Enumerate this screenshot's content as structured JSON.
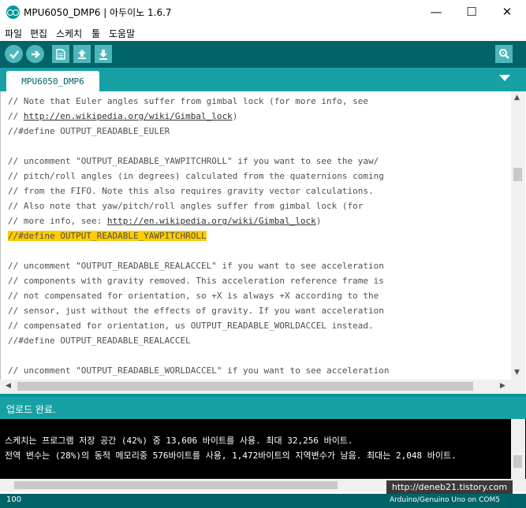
{
  "window": {
    "title": "MPU6050_DMP6 | 아두이노 1.6.7",
    "minimize": "—",
    "maximize": "☐",
    "close": "✕"
  },
  "menu": [
    "파일",
    "편집",
    "스케치",
    "툴",
    "도움말"
  ],
  "toolbar": {
    "buttons": [
      "verify-icon",
      "upload-icon",
      "new-icon",
      "open-icon",
      "save-icon"
    ],
    "serial_monitor": "serial-monitor-icon"
  },
  "tabs": [
    {
      "label": "MPU6050_DMP6"
    }
  ],
  "code": {
    "lines": [
      {
        "pre": "// Note that Euler angles suffer from gimbal lock (for more info, see",
        "link": "",
        "post": ""
      },
      {
        "pre": "// ",
        "link": "http://en.wikipedia.org/wiki/Gimbal_lock",
        "post": ")"
      },
      {
        "pre": "//#define OUTPUT_READABLE_EULER",
        "link": "",
        "post": ""
      },
      {
        "pre": "",
        "link": "",
        "post": ""
      },
      {
        "pre": "// uncomment \"OUTPUT_READABLE_YAWPITCHROLL\" if you want to see the yaw/",
        "link": "",
        "post": ""
      },
      {
        "pre": "// pitch/roll angles (in degrees) calculated from the quaternions coming",
        "link": "",
        "post": ""
      },
      {
        "pre": "// from the FIFO. Note this also requires gravity vector calculations.",
        "link": "",
        "post": ""
      },
      {
        "pre": "// Also note that yaw/pitch/roll angles suffer from gimbal lock (for",
        "link": "",
        "post": ""
      },
      {
        "pre": "// more info, see: ",
        "link": "http://en.wikipedia.org/wiki/Gimbal_lock",
        "post": ")"
      },
      {
        "pre": "//#define OUTPUT_READABLE_YAWPITCHROLL",
        "link": "",
        "post": "",
        "highlight": true
      },
      {
        "pre": "",
        "link": "",
        "post": ""
      },
      {
        "pre": "// uncomment \"OUTPUT_READABLE_REALACCEL\" if you want to see acceleration",
        "link": "",
        "post": ""
      },
      {
        "pre": "// components with gravity removed. This acceleration reference frame is",
        "link": "",
        "post": ""
      },
      {
        "pre": "// not compensated for orientation, so +X is always +X according to the",
        "link": "",
        "post": ""
      },
      {
        "pre": "// sensor, just without the effects of gravity. If you want acceleration",
        "link": "",
        "post": ""
      },
      {
        "pre": "// compensated for orientation, us OUTPUT_READABLE_WORLDACCEL instead.",
        "link": "",
        "post": ""
      },
      {
        "pre": "//#define OUTPUT_READABLE_REALACCEL",
        "link": "",
        "post": ""
      },
      {
        "pre": "",
        "link": "",
        "post": ""
      },
      {
        "pre": "// uncomment \"OUTPUT_READABLE_WORLDACCEL\" if you want to see acceleration",
        "link": "",
        "post": ""
      }
    ]
  },
  "status": {
    "message": "업로드 완료."
  },
  "console": {
    "lines": [
      "스케치는 프로그램 저장 공간 (42%) 중 13,606 바이트를 사용. 최대 32,256 바이트.",
      "전역 변수는 (28%)의 동적 메모리중 576바이트를 사용, 1,472바이트의 지역변수가 남음. 최대는 2,048 바이트."
    ]
  },
  "watermark": "http://deneb21.tistory.com",
  "footer": {
    "line_number": "100",
    "board": "Arduino/Genuino Uno on COM5"
  },
  "colors": {
    "toolbar": "#006468",
    "tabbar": "#17a1a5",
    "button": "#4db7bb",
    "highlight": "#ffcc00",
    "console": "#000000"
  }
}
